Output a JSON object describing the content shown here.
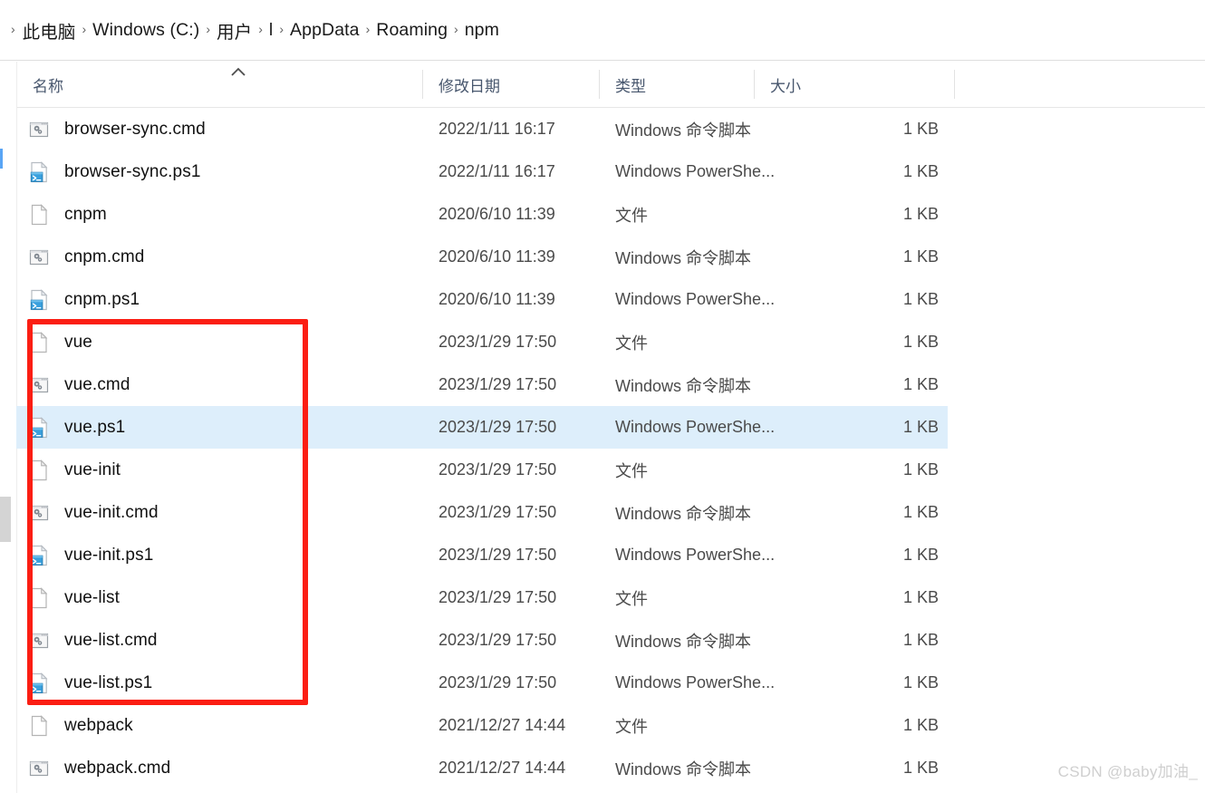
{
  "breadcrumb": {
    "separator": "›",
    "items": [
      {
        "label": "此电脑"
      },
      {
        "label": "Windows (C:)"
      },
      {
        "label": "用户"
      },
      {
        "label": "l"
      },
      {
        "label": "AppData"
      },
      {
        "label": "Roaming"
      },
      {
        "label": "npm"
      }
    ]
  },
  "columns": {
    "name": "名称",
    "date_modified": "修改日期",
    "type": "类型",
    "size": "大小",
    "sort": {
      "column": "名称",
      "direction": "ascending",
      "icon": "chevron-up-icon"
    }
  },
  "colors": {
    "selection": "#ddeefb",
    "annotation": "#fb1e13",
    "header_text": "#47566d",
    "accent": "#59a5f5",
    "watermark": "#cfcfcf"
  },
  "files": [
    {
      "name": "browser-sync.cmd",
      "icon": "cmd-script-icon",
      "date": "2022/1/11 16:17",
      "type": "Windows 命令脚本",
      "size": "1 KB",
      "selected": false
    },
    {
      "name": "browser-sync.ps1",
      "icon": "powershell-script-icon",
      "date": "2022/1/11 16:17",
      "type": "Windows PowerShe...",
      "size": "1 KB",
      "selected": false
    },
    {
      "name": "cnpm",
      "icon": "generic-file-icon",
      "date": "2020/6/10 11:39",
      "type": "文件",
      "size": "1 KB",
      "selected": false
    },
    {
      "name": "cnpm.cmd",
      "icon": "cmd-script-icon",
      "date": "2020/6/10 11:39",
      "type": "Windows 命令脚本",
      "size": "1 KB",
      "selected": false
    },
    {
      "name": "cnpm.ps1",
      "icon": "powershell-script-icon",
      "date": "2020/6/10 11:39",
      "type": "Windows PowerShe...",
      "size": "1 KB",
      "selected": false
    },
    {
      "name": "vue",
      "icon": "generic-file-icon",
      "date": "2023/1/29 17:50",
      "type": "文件",
      "size": "1 KB",
      "selected": false
    },
    {
      "name": "vue.cmd",
      "icon": "cmd-script-icon",
      "date": "2023/1/29 17:50",
      "type": "Windows 命令脚本",
      "size": "1 KB",
      "selected": false
    },
    {
      "name": "vue.ps1",
      "icon": "powershell-script-icon",
      "date": "2023/1/29 17:50",
      "type": "Windows PowerShe...",
      "size": "1 KB",
      "selected": true
    },
    {
      "name": "vue-init",
      "icon": "generic-file-icon",
      "date": "2023/1/29 17:50",
      "type": "文件",
      "size": "1 KB",
      "selected": false
    },
    {
      "name": "vue-init.cmd",
      "icon": "cmd-script-icon",
      "date": "2023/1/29 17:50",
      "type": "Windows 命令脚本",
      "size": "1 KB",
      "selected": false
    },
    {
      "name": "vue-init.ps1",
      "icon": "powershell-script-icon",
      "date": "2023/1/29 17:50",
      "type": "Windows PowerShe...",
      "size": "1 KB",
      "selected": false
    },
    {
      "name": "vue-list",
      "icon": "generic-file-icon",
      "date": "2023/1/29 17:50",
      "type": "文件",
      "size": "1 KB",
      "selected": false
    },
    {
      "name": "vue-list.cmd",
      "icon": "cmd-script-icon",
      "date": "2023/1/29 17:50",
      "type": "Windows 命令脚本",
      "size": "1 KB",
      "selected": false
    },
    {
      "name": "vue-list.ps1",
      "icon": "powershell-script-icon",
      "date": "2023/1/29 17:50",
      "type": "Windows PowerShe...",
      "size": "1 KB",
      "selected": false
    },
    {
      "name": "webpack",
      "icon": "generic-file-icon",
      "date": "2021/12/27 14:44",
      "type": "文件",
      "size": "1 KB",
      "selected": false
    },
    {
      "name": "webpack.cmd",
      "icon": "cmd-script-icon",
      "date": "2021/12/27 14:44",
      "type": "Windows 命令脚本",
      "size": "1 KB",
      "selected": false
    }
  ],
  "annotation": {
    "shape": "rectangle",
    "highlights_files": [
      "vue",
      "vue.cmd",
      "vue.ps1",
      "vue-init",
      "vue-init.cmd",
      "vue-init.ps1",
      "vue-list",
      "vue-list.cmd",
      "vue-list.ps1"
    ]
  },
  "watermark": {
    "text": "CSDN @baby加油_"
  }
}
